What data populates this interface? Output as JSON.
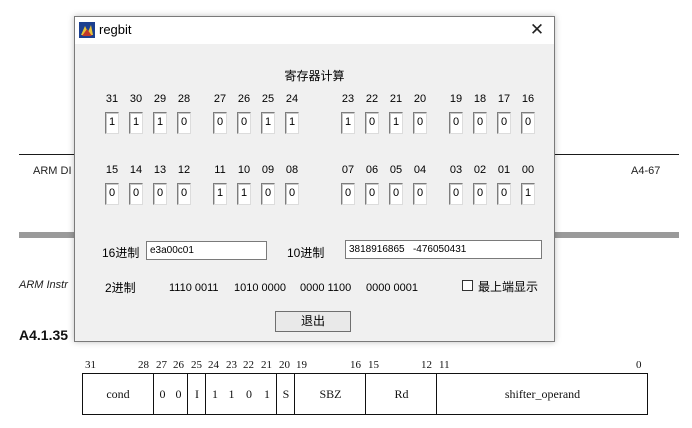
{
  "window": {
    "title": "regbit",
    "close_glyph": "✕"
  },
  "heading": "寄存器计算",
  "bits_high": [
    {
      "n": "31",
      "v": "1"
    },
    {
      "n": "30",
      "v": "1"
    },
    {
      "n": "29",
      "v": "1"
    },
    {
      "n": "28",
      "v": "0"
    },
    {
      "n": "27",
      "v": "0"
    },
    {
      "n": "26",
      "v": "0"
    },
    {
      "n": "25",
      "v": "1"
    },
    {
      "n": "24",
      "v": "1"
    },
    {
      "n": "23",
      "v": "1"
    },
    {
      "n": "22",
      "v": "0"
    },
    {
      "n": "21",
      "v": "1"
    },
    {
      "n": "20",
      "v": "0"
    },
    {
      "n": "19",
      "v": "0"
    },
    {
      "n": "18",
      "v": "0"
    },
    {
      "n": "17",
      "v": "0"
    },
    {
      "n": "16",
      "v": "0"
    }
  ],
  "bits_low": [
    {
      "n": "15",
      "v": "0"
    },
    {
      "n": "14",
      "v": "0"
    },
    {
      "n": "13",
      "v": "0"
    },
    {
      "n": "12",
      "v": "0"
    },
    {
      "n": "11",
      "v": "1"
    },
    {
      "n": "10",
      "v": "1"
    },
    {
      "n": "09",
      "v": "0"
    },
    {
      "n": "08",
      "v": "0"
    },
    {
      "n": "07",
      "v": "0"
    },
    {
      "n": "06",
      "v": "0"
    },
    {
      "n": "05",
      "v": "0"
    },
    {
      "n": "04",
      "v": "0"
    },
    {
      "n": "03",
      "v": "0"
    },
    {
      "n": "02",
      "v": "0"
    },
    {
      "n": "01",
      "v": "0"
    },
    {
      "n": "00",
      "v": "1"
    }
  ],
  "hex": {
    "label": "16进制",
    "value": "e3a00c01"
  },
  "dec": {
    "label": "10进制",
    "value": "3818916865   -476050431"
  },
  "bin": {
    "label": "2进制",
    "groups": [
      "1110 0011",
      "1010 0000",
      "0000 1100",
      "0000 0001"
    ]
  },
  "topmost": {
    "label": "最上端显示",
    "checked": false
  },
  "exit_button": "退出",
  "document": {
    "footer_left": "ARM DI",
    "footer_right": "A4-67",
    "section_italic": "ARM Instr",
    "section_heading": "A4.1.35",
    "bit_indices": [
      "31",
      "28",
      "27",
      "26",
      "25",
      "24",
      "23",
      "22",
      "21",
      "20",
      "19",
      "16",
      "15",
      "12",
      "11",
      "0"
    ],
    "fields": [
      "cond",
      "0",
      "0",
      "I",
      "1",
      "1",
      "0",
      "1",
      "S",
      "SBZ",
      "Rd",
      "shifter_operand"
    ]
  }
}
